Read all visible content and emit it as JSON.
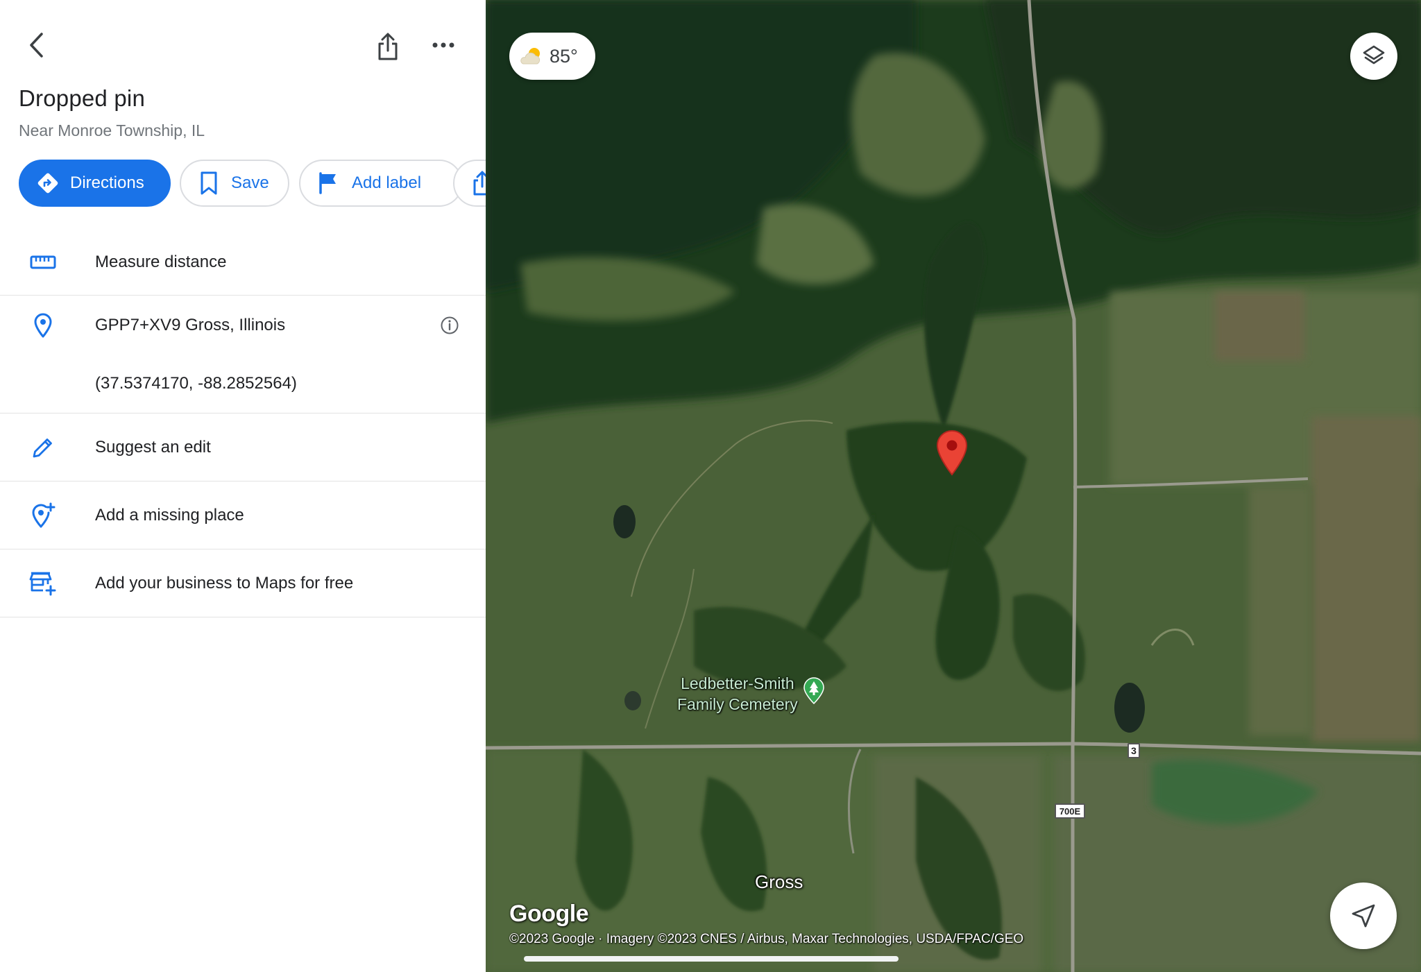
{
  "header": {
    "title": "Dropped pin",
    "subtitle": "Near Monroe Township, IL"
  },
  "actions": {
    "directions": "Directions",
    "save": "Save",
    "add_label": "Add label"
  },
  "details": {
    "measure_distance": "Measure distance",
    "plus_code": "GPP7+XV9 Gross, Illinois",
    "coordinates": "(37.5374170, -88.2852564)",
    "suggest_edit": "Suggest an edit",
    "add_missing_place": "Add a missing place",
    "add_business": "Add your business to Maps for free"
  },
  "map": {
    "weather_temp": "85°",
    "poi_name_line1": "Ledbetter-Smith",
    "poi_name_line2": "Family Cemetery",
    "place_label": "Gross",
    "route_shield_1": "3",
    "route_shield_2": "700E",
    "logo": "Google",
    "attribution": "©2023 Google · Imagery ©2023 CNES / Airbus, Maxar Technologies, USDA/FPAC/GEO"
  },
  "colors": {
    "accent": "#1a73e8",
    "pin": "#ea4335",
    "poi_green": "#34a853"
  },
  "icons": {
    "back": "back-arrow-icon",
    "share": "share-icon",
    "more": "more-horizontal-icon",
    "directions": "directions-icon",
    "save": "bookmark-icon",
    "label": "flag-icon",
    "measure": "ruler-icon",
    "location": "location-pin-icon",
    "info": "info-icon",
    "edit": "pencil-icon",
    "add_place": "add-location-icon",
    "business": "add-business-icon",
    "weather": "partly-sunny-icon",
    "layers": "layers-icon",
    "locate": "navigation-arrow-icon"
  }
}
